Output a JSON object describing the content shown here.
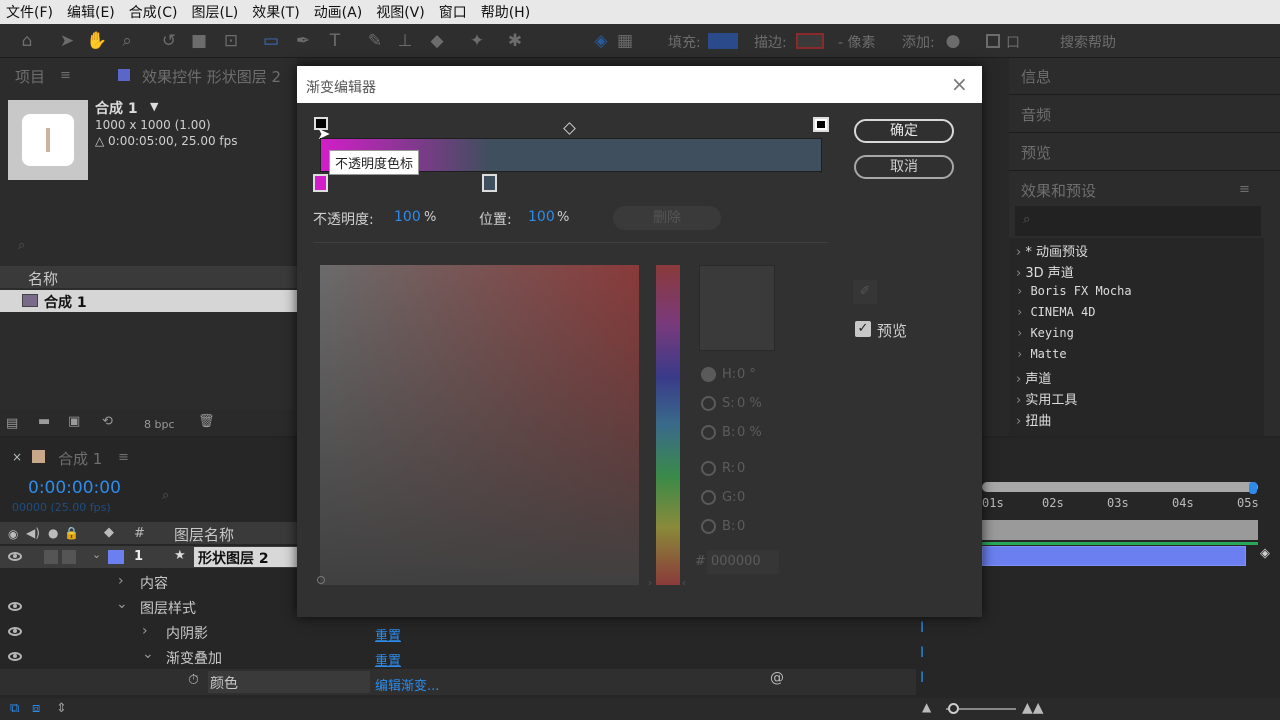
{
  "menubar": {
    "items": [
      "文件(F)",
      "编辑(E)",
      "合成(C)",
      "图层(L)",
      "效果(T)",
      "动画(A)",
      "视图(V)",
      "窗口",
      "帮助(H)"
    ]
  },
  "toolbar": {
    "fill_label": "填充:",
    "stroke_label": "描边:",
    "stroke_unit": "- 像素",
    "add_label": "添加:",
    "search_help": "搜索帮助",
    "search_prefix": "口"
  },
  "project": {
    "tab_label": "项目",
    "effects_tab": "效果控件 形状图层 2",
    "comp_name": "合成 1",
    "comp_size": "1000 x 1000 (1.00)",
    "comp_duration": "△ 0:00:05:00, 25.00 fps",
    "col_name": "名称",
    "item_name": "合成 1",
    "bpc": "8 bpc"
  },
  "right_panel": {
    "info": "信息",
    "audio": "音频",
    "preview": "预览",
    "effects_presets": "效果和预设",
    "items": [
      "* 动画预设",
      "3D 声道",
      "Boris FX Mocha",
      "CINEMA 4D",
      "Keying",
      "Matte",
      "声道",
      "实用工具",
      "扭曲"
    ]
  },
  "timeline": {
    "tab_label": "合成 1",
    "timecode": "0:00:00:00",
    "frame_info": "00000 (25.00 fps)",
    "col_hash": "#",
    "col_layer_name": "图层名称",
    "layer_num": "1",
    "layer_name": "形状图层 2",
    "contents": "内容",
    "layer_styles": "图层样式",
    "inner_shadow": "内阴影",
    "gradient_overlay": "渐变叠加",
    "color": "颜色",
    "reset1": "重置",
    "reset2": "重置",
    "edit_gradient": "编辑渐变...",
    "ruler": [
      "01s",
      "02s",
      "03s",
      "04s",
      "05s"
    ]
  },
  "dialog": {
    "title": "渐变编辑器",
    "ok": "确定",
    "cancel": "取消",
    "tooltip": "不透明度色标",
    "opacity_label": "不透明度:",
    "opacity_value": "100",
    "opacity_unit": "%",
    "position_label": "位置:",
    "position_value": "100",
    "position_unit": "%",
    "delete_label": "删除",
    "preview_label": "预览",
    "preview_checked": true,
    "h_label": "H:",
    "h_value": "0 °",
    "s_label": "S:",
    "s_value": "0 %",
    "b_label": "B:",
    "b_value": "0 %",
    "r_label": "R:",
    "r_value": "0",
    "g_label": "G:",
    "g_value": "0",
    "bl_label": "B:",
    "bl_value": "0",
    "hex_label": "#",
    "hex_value": "000000"
  },
  "colors": {
    "accent_blue": "#2d8ceb",
    "gradient_start": "#d21ec8",
    "gradient_end": "#3f4f5d",
    "layer_color": "#6b7ff0"
  }
}
